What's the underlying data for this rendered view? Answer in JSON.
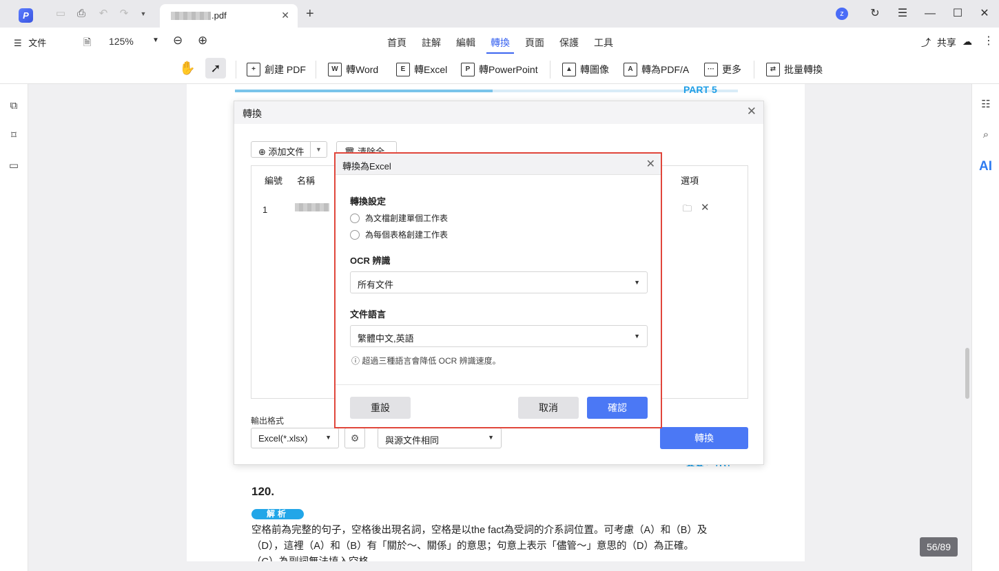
{
  "titlebar": {
    "logo": "P",
    "tab_title": ".pdf",
    "tab_close": "✕",
    "new_tab": "+",
    "user_initial": "z",
    "icons": [
      "save-icon",
      "print-icon",
      "undo-icon",
      "redo-icon",
      "dropdown-icon"
    ]
  },
  "menu": {
    "file": "文件",
    "zoom": "125%",
    "tabs": [
      "首頁",
      "註解",
      "編輯",
      "轉換",
      "頁面",
      "保護",
      "工具"
    ],
    "active_tab": "轉換",
    "share": "共享"
  },
  "toolbar": {
    "create_pdf": "創建 PDF",
    "to_word": "轉Word",
    "to_excel": "轉Excel",
    "to_ppt": "轉PowerPoint",
    "to_image": "轉圖像",
    "to_pdfa": "轉為PDF/A",
    "more": "更多",
    "batch": "批量轉換"
  },
  "rightrail": {
    "ai": "AI"
  },
  "document": {
    "part_label": "PART 5",
    "question_number": "120.",
    "analysis_pill": "解析",
    "para_line1": "空格前為完整的句子，空格後出現名詞，空格是以the fact為受詞的介系詞位置。可考慮（A）和（B）及",
    "para_line2": "（D），這裡（A）和（B）有「關於～、關係」的意思；句意上表示「儘管～」意思的（D）為正確。",
    "para_line3": "（C）為副詞無法填入空格。",
    "answer_partial": "答案：（D）",
    "page_indicator": "56/89"
  },
  "convert_dialog": {
    "title": "轉換",
    "add_file": "添加文件",
    "clear_all": "清除全部",
    "columns": {
      "number": "編號",
      "name": "名稱",
      "options": "選項"
    },
    "rows": [
      {
        "number": "1"
      }
    ],
    "output_format_label": "輸出格式",
    "output_format": "Excel(*.xlsx)",
    "output_folder": "與源文件相同",
    "convert_button": "轉換"
  },
  "excel_dialog": {
    "title": "轉換為Excel",
    "section_conversion": "轉換設定",
    "option_single_sheet": "為文檔創建單個工作表",
    "option_per_table": "為每個表格創建工作表",
    "section_ocr": "OCR 辨識",
    "ocr_value": "所有文件",
    "section_language": "文件語言",
    "language_value": "繁體中文,英語",
    "note": "ⓘ 超過三種語言會降低 OCR 辨識速度。",
    "reset": "重設",
    "cancel": "取消",
    "confirm": "確認"
  }
}
